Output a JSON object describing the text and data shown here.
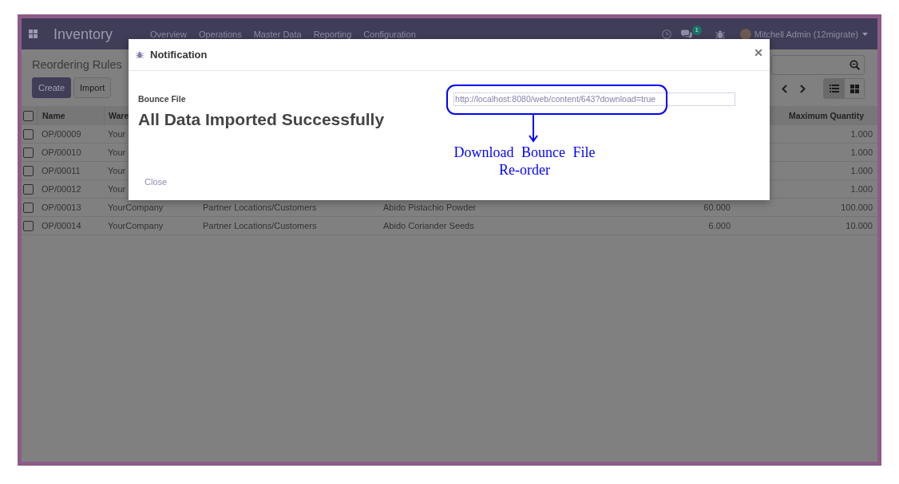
{
  "navbar": {
    "app_title": "Inventory",
    "menu": [
      "Overview",
      "Operations",
      "Master Data",
      "Reporting",
      "Configuration"
    ],
    "message_count": "1",
    "user_name": "Mitchell Admin (12migrate)"
  },
  "control_panel": {
    "breadcrumb": "Reordering Rules",
    "buttons": [
      {
        "label": "Create",
        "kind": "primary"
      },
      {
        "label": "Import",
        "kind": "secondary"
      }
    ],
    "views": [
      {
        "kind": "list",
        "selected": true
      },
      {
        "kind": "kanban",
        "selected": false
      }
    ]
  },
  "table": {
    "select_all_checked": false,
    "header": {
      "name": "Name",
      "column_2": "Ware",
      "maximum_quantity": "Maximum Quantity"
    },
    "rows": [
      {
        "checked": false,
        "name": "OP/00009",
        "column_2": "Your",
        "maximum_quantity": "1.000"
      },
      {
        "checked": false,
        "name": "OP/00010",
        "column_2": "Your",
        "maximum_quantity": "1.000"
      },
      {
        "checked": false,
        "name": "OP/00011",
        "column_2": "Your",
        "maximum_quantity": "1.000"
      },
      {
        "checked": false,
        "name": "OP/00012",
        "column_2": "Your",
        "maximum_quantity": "1.000"
      },
      {
        "checked": false,
        "name": "OP/00013",
        "column_2": "YourCompany",
        "column_3": "Partner Locations/Customers",
        "column_4": "Abido Pistachio Powder",
        "column_5": "60.000",
        "maximum_quantity": "100.000"
      },
      {
        "checked": false,
        "name": "OP/00014",
        "column_2": "YourCompany",
        "column_3": "Partner Locations/Customers",
        "column_4": "Abido Coriander Seeds",
        "column_5": "6.000",
        "maximum_quantity": "10.000"
      }
    ]
  },
  "dialog": {
    "title": "Notification",
    "field_label": "Bounce File",
    "message": "All Data Imported Successfully",
    "file_url": "http://localhost:8080/web/content/643?download=true",
    "footer_button": "Close"
  },
  "annotation": {
    "lines": [
      "Download Bounce File",
      "Re-order"
    ]
  }
}
